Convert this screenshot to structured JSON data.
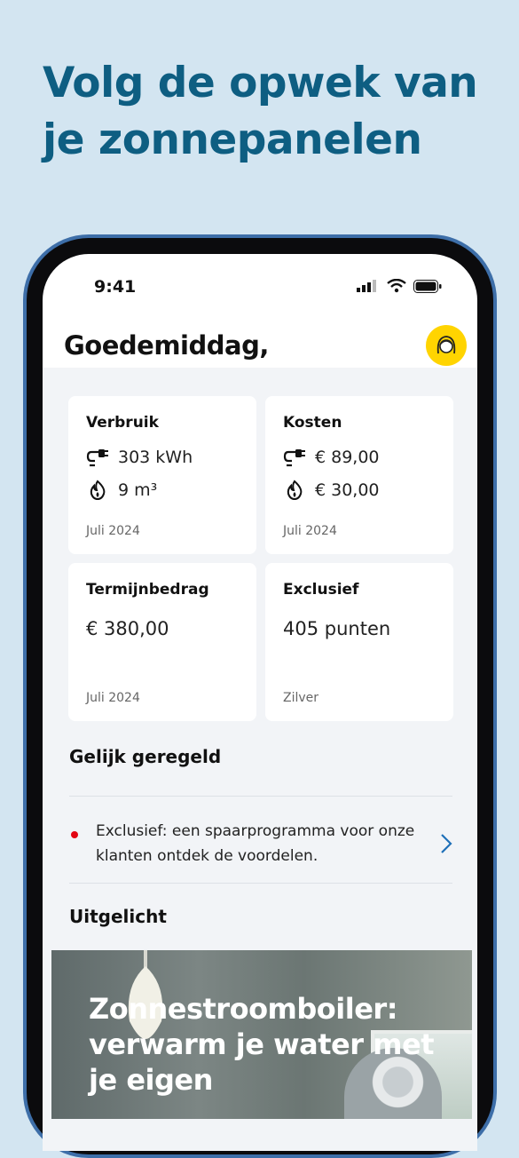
{
  "promo": {
    "title": "Volg de opwek van je zonnepanelen"
  },
  "status_bar": {
    "time": "9:41"
  },
  "header": {
    "greeting": "Goedemiddag,"
  },
  "cards": {
    "verbruik": {
      "title": "Verbruik",
      "electricity": "303 kWh",
      "gas": "9 m³",
      "period": "Juli 2024"
    },
    "kosten": {
      "title": "Kosten",
      "electricity": "€ 89,00",
      "gas": "€ 30,00",
      "period": "Juli 2024"
    },
    "termijnbedrag": {
      "title": "Termijnbedrag",
      "value": "€ 380,00",
      "period": "Juli 2024"
    },
    "exclusief": {
      "title": "Exclusief",
      "value": "405 punten",
      "level": "Zilver"
    }
  },
  "sections": {
    "gelijk_geregeld": {
      "title": "Gelijk geregeld"
    },
    "notice": {
      "text": "Exclusief: een spaarprogramma voor onze klanten ontdek de voordelen."
    },
    "uitgelicht": {
      "title": "Uitgelicht",
      "feature_headline": "Zonnestroomboiler: verwarm je water met je eigen"
    }
  },
  "colors": {
    "accent_blue": "#0e5e82",
    "avatar_yellow": "#ffd400",
    "notice_dot": "#e30613",
    "chevron": "#1e6fb8"
  }
}
